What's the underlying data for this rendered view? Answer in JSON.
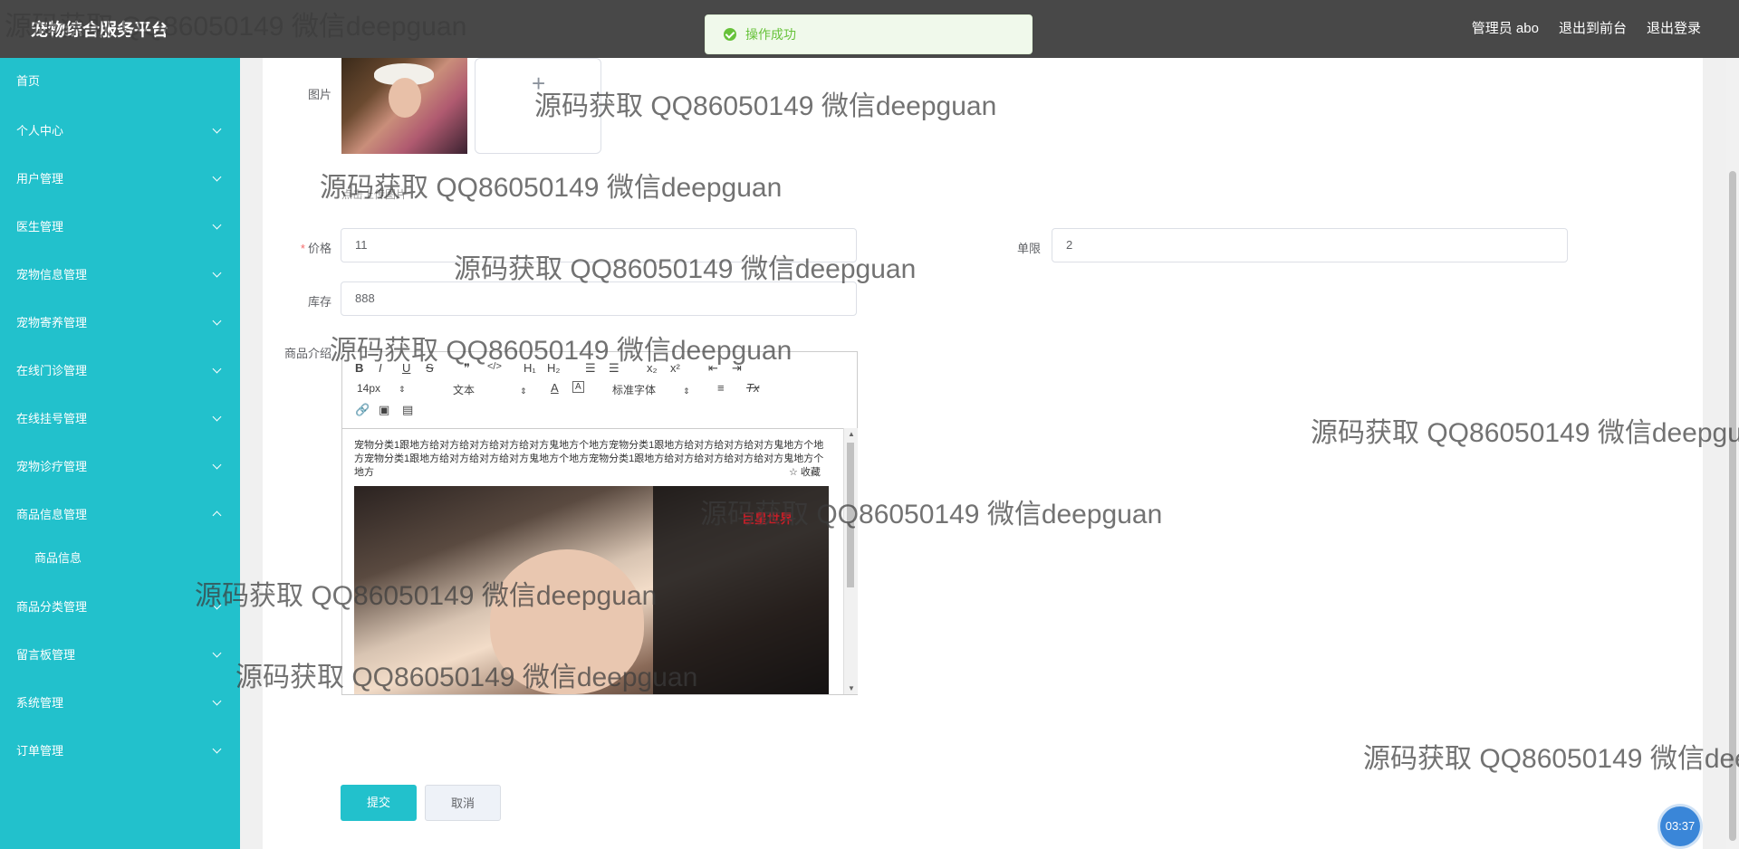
{
  "header": {
    "brand": "宠物综合服务平台",
    "user": "管理员 abo",
    "back_front": "退出到前台",
    "logout": "退出登录"
  },
  "toast": {
    "message": "操作成功"
  },
  "sidebar": {
    "items": [
      {
        "label": "首页"
      },
      {
        "label": "个人中心"
      },
      {
        "label": "用户管理"
      },
      {
        "label": "医生管理"
      },
      {
        "label": "宠物信息管理"
      },
      {
        "label": "宠物寄养管理"
      },
      {
        "label": "在线门诊管理"
      },
      {
        "label": "在线挂号管理"
      },
      {
        "label": "宠物诊疗管理"
      },
      {
        "label": "商品信息管理"
      },
      {
        "label": "商品信息"
      },
      {
        "label": "商品分类管理"
      },
      {
        "label": "留言板管理"
      },
      {
        "label": "系统管理"
      },
      {
        "label": "订单管理"
      }
    ]
  },
  "form": {
    "image_label": "图片",
    "upload_hint": "点击上传图片",
    "price_label": "价格",
    "price_value": "11",
    "limit_label": "单限",
    "limit_value": "2",
    "stock_label": "库存",
    "stock_value": "888",
    "intro_label": "商品介绍"
  },
  "editor": {
    "toolbar": {
      "bold": "B",
      "italic": "I",
      "underline": "U",
      "strike": "S",
      "quote": "❞",
      "code": "</>",
      "h1": "H₁",
      "h2": "H₂",
      "ol": "☰",
      "ul": "☰",
      "sub": "x₂",
      "sup": "x²",
      "outdent": "⇤",
      "indent": "⇥",
      "size": "14px",
      "header": "文本",
      "font": "标准字体",
      "link": "🔗",
      "image": "▣",
      "video": "▤",
      "color": "A",
      "bg": "A",
      "align": "≡",
      "clean": "Tx"
    },
    "content": "宠物分类1跟地方给对方给对方给对方给对方鬼地方个地方宠物分类1跟地方给对方给对方给对方鬼地方个地方宠物分类1跟地方给对方给对方给对方鬼地方个地方宠物分类1跟地方给对方给对方给对方给对方鬼地方个地方",
    "favorite": "☆ 收藏",
    "photo_stamp": "巨星世界"
  },
  "buttons": {
    "submit": "提交",
    "cancel": "取消"
  },
  "clock": "03:37",
  "watermark": "源码获取 QQ86050149 微信deepguan",
  "colors": {
    "sidebar": "#22c1cc",
    "header": "#484848",
    "accent": "#22c1cc"
  }
}
